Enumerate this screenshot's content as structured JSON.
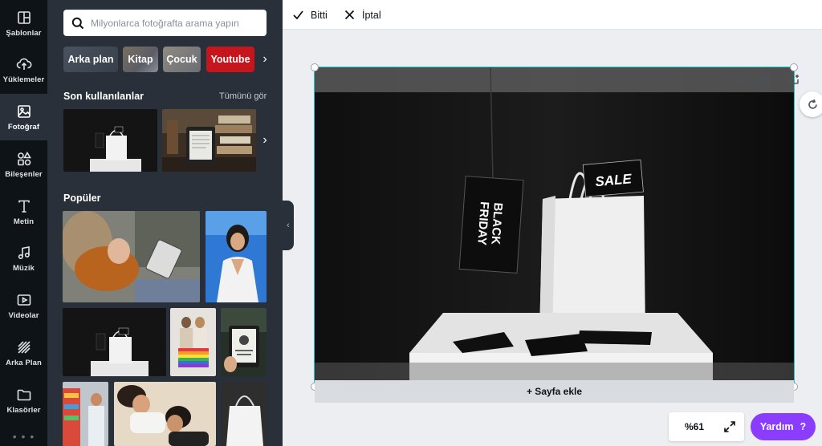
{
  "sidebar": {
    "items": [
      {
        "label": "Şablonlar",
        "icon": "layout-icon"
      },
      {
        "label": "Yüklemeler",
        "icon": "upload-cloud-icon"
      },
      {
        "label": "Fotoğraf",
        "icon": "image-icon",
        "active": true
      },
      {
        "label": "Bileşenler",
        "icon": "shapes-icon"
      },
      {
        "label": "Metin",
        "icon": "text-icon"
      },
      {
        "label": "Müzik",
        "icon": "music-note-icon"
      },
      {
        "label": "Videolar",
        "icon": "video-play-icon"
      },
      {
        "label": "Arka Plan",
        "icon": "pattern-icon"
      },
      {
        "label": "Klasörler",
        "icon": "folder-icon"
      }
    ],
    "more": "• • •"
  },
  "photo_panel": {
    "search_placeholder": "Milyonlarca fotoğrafta arama yapın",
    "chips": [
      "Arka plan",
      "Kitap",
      "Çocuk",
      "Youtube"
    ],
    "recent_title": "Son kullanılanlar",
    "see_all": "Tümünü gör",
    "popular_title": "Popüler"
  },
  "toolbar": {
    "done_label": "Bitti",
    "cancel_label": "İptal"
  },
  "canvas": {
    "tag_text_1": "BLACK",
    "tag_text_2": "FRIDAY",
    "sale_text": "SALE",
    "add_page_label": "+ Sayfa ekle"
  },
  "footer": {
    "zoom": "%61",
    "help_label": "Yardım",
    "help_icon": "?"
  },
  "colors": {
    "accent_teal": "#20c4cb",
    "help_purple": "#8b3dff",
    "youtube_red": "#c4161c",
    "rail_bg": "#0e1318",
    "panel_bg": "#293039"
  }
}
